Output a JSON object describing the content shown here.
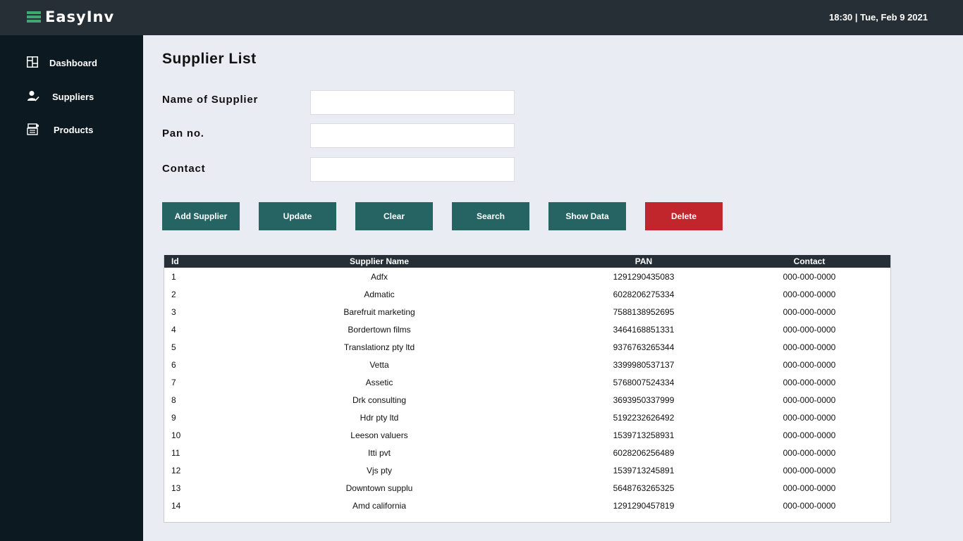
{
  "app": {
    "title": "EasyInv"
  },
  "header": {
    "datetime": "18:30 | Tue, Feb 9 2021"
  },
  "sidebar": {
    "items": [
      {
        "label": "Dashboard",
        "icon": "dashboard-grid-icon"
      },
      {
        "label": "Suppliers",
        "icon": "supplier-user-icon"
      },
      {
        "label": "Products",
        "icon": "products-box-icon"
      }
    ]
  },
  "main": {
    "title": "Supplier List",
    "form": {
      "name_label": "Name of Supplier",
      "name_value": "",
      "pan_label": "Pan no.",
      "pan_value": "",
      "contact_label": "Contact",
      "contact_value": ""
    },
    "buttons": {
      "add": "Add Supplier",
      "update": "Update",
      "clear": "Clear",
      "search": "Search",
      "show": "Show Data",
      "delete": "Delete"
    },
    "table": {
      "headers": [
        "Id",
        "Supplier Name",
        "PAN",
        "Contact"
      ],
      "rows": [
        [
          "1",
          "Adfx",
          "1291290435083",
          "000-000-0000"
        ],
        [
          "2",
          "Admatic",
          "6028206275334",
          "000-000-0000"
        ],
        [
          "3",
          "Barefruit marketing",
          "7588138952695",
          "000-000-0000"
        ],
        [
          "4",
          "Bordertown films",
          "3464168851331",
          "000-000-0000"
        ],
        [
          "5",
          "Translationz pty ltd",
          "9376763265344",
          "000-000-0000"
        ],
        [
          "6",
          "Vetta",
          "3399980537137",
          "000-000-0000"
        ],
        [
          "7",
          "Assetic",
          "5768007524334",
          "000-000-0000"
        ],
        [
          "8",
          "Drk consulting",
          "3693950337999",
          "000-000-0000"
        ],
        [
          "9",
          "Hdr pty ltd",
          "5192232626492",
          "000-000-0000"
        ],
        [
          "10",
          "Leeson valuers",
          "1539713258931",
          "000-000-0000"
        ],
        [
          "11",
          "Itti pvt",
          "6028206256489",
          "000-000-0000"
        ],
        [
          "12",
          "Vjs pty",
          "1539713245891",
          "000-000-0000"
        ],
        [
          "13",
          "Downtown supplu",
          "5648763265325",
          "000-000-0000"
        ],
        [
          "14",
          "Amd california",
          "1291290457819",
          "000-000-0000"
        ]
      ]
    }
  },
  "colors": {
    "topbar": "#272f36",
    "sidebar": "#0c1921",
    "background": "#e9ecf3",
    "accent": "#266463",
    "danger": "#c1262c",
    "logo_green": "#3fa873"
  }
}
